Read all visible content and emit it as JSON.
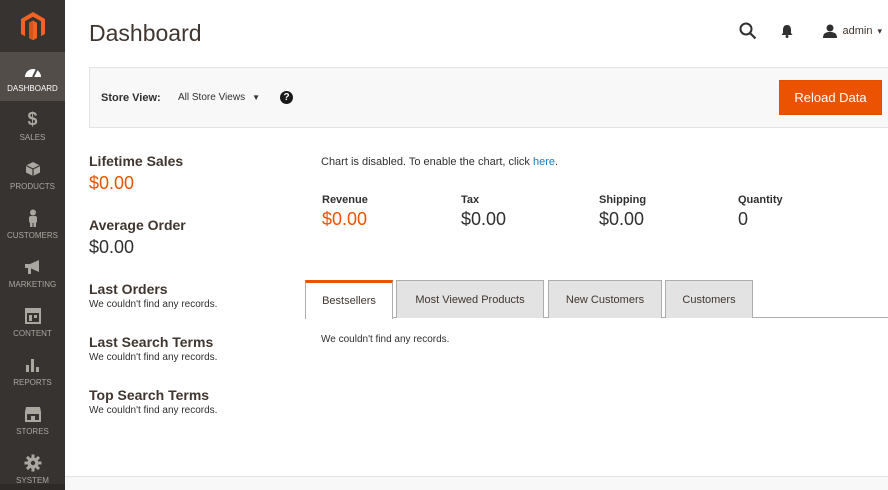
{
  "sidebar": {
    "logo": "magento-logo",
    "items": [
      {
        "label": "DASHBOARD",
        "icon": "speedometer-icon",
        "active": true
      },
      {
        "label": "SALES",
        "icon": "dollar-icon",
        "active": false
      },
      {
        "label": "PRODUCTS",
        "icon": "cube-icon",
        "active": false
      },
      {
        "label": "CUSTOMERS",
        "icon": "person-icon",
        "active": false
      },
      {
        "label": "MARKETING",
        "icon": "megaphone-icon",
        "active": false
      },
      {
        "label": "CONTENT",
        "icon": "layout-icon",
        "active": false
      },
      {
        "label": "REPORTS",
        "icon": "bar-chart-icon",
        "active": false
      },
      {
        "label": "STORES",
        "icon": "storefront-icon",
        "active": false
      },
      {
        "label": "SYSTEM",
        "icon": "gear-icon",
        "active": false
      }
    ]
  },
  "header": {
    "title": "Dashboard",
    "user": "admin"
  },
  "store_bar": {
    "label": "Store View:",
    "selected": "All Store Views",
    "help": "?",
    "reload_label": "Reload Data"
  },
  "left": {
    "lifetime_sales_label": "Lifetime Sales",
    "lifetime_sales_value": "$0.00",
    "average_order_label": "Average Order",
    "average_order_value": "$0.00",
    "sections": [
      {
        "title": "Last Orders",
        "note": "We couldn't find any records."
      },
      {
        "title": "Last Search Terms",
        "note": "We couldn't find any records."
      },
      {
        "title": "Top Search Terms",
        "note": "We couldn't find any records."
      }
    ]
  },
  "chart_note": {
    "text": "Chart is disabled. To enable the chart, click ",
    "link": "here",
    "suffix": "."
  },
  "totals": [
    {
      "label": "Revenue",
      "value": "$0.00"
    },
    {
      "label": "Tax",
      "value": "$0.00"
    },
    {
      "label": "Shipping",
      "value": "$0.00"
    },
    {
      "label": "Quantity",
      "value": "0"
    }
  ],
  "tabs": [
    {
      "label": "Bestsellers",
      "active": true
    },
    {
      "label": "Most Viewed Products",
      "active": false
    },
    {
      "label": "New Customers",
      "active": false
    },
    {
      "label": "Customers",
      "active": false
    }
  ],
  "tab_content_note": "We couldn't find any records.",
  "colors": {
    "accent": "#eb5202",
    "sidebar_bg": "#373330",
    "link": "#1979c3"
  }
}
